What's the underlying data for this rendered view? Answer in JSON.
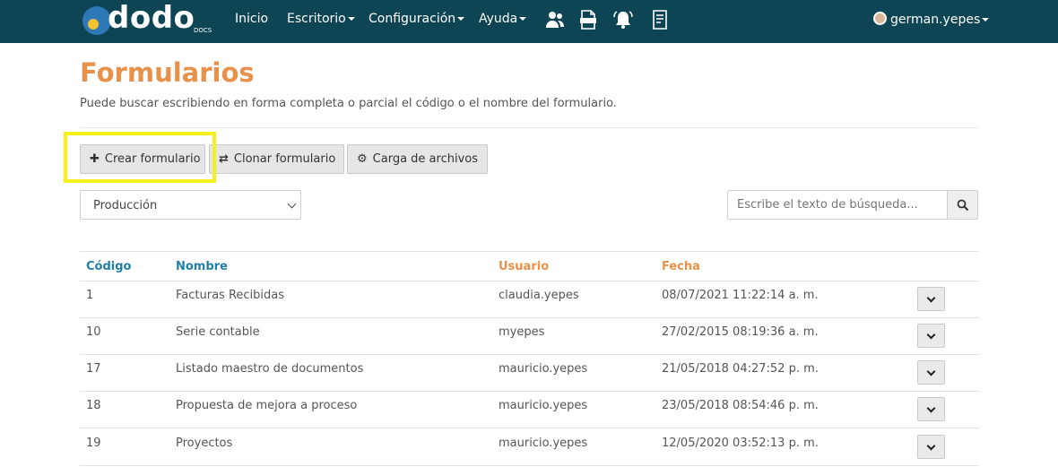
{
  "navbar": {
    "logo_text": "dodo",
    "logo_sub": "DOCS",
    "menu": [
      {
        "label": "Inicio",
        "dropdown": false
      },
      {
        "label": "Escritorio",
        "dropdown": true
      },
      {
        "label": "Configuración",
        "dropdown": true
      },
      {
        "label": "Ayuda",
        "dropdown": true
      }
    ],
    "icons": [
      "users-icon",
      "xlsx-file-icon",
      "bell-icon",
      "document-icon"
    ],
    "user": "german.yepes",
    "bg_color": "#0e4554"
  },
  "page": {
    "title": "Formularios",
    "description": "Puede buscar escribiendo en forma completa o parcial el código o el nombre del formulario.",
    "title_color": "#e8914a"
  },
  "toolbar": {
    "create_label": "Crear formulario",
    "clone_label": "Clonar formulario",
    "upload_label": "Carga de archivos"
  },
  "filter": {
    "environment_value": "Producción",
    "search_placeholder": "Escribe el texto de búsqueda..."
  },
  "table": {
    "columns": [
      "Código",
      "Nombre",
      "Usuario",
      "Fecha"
    ],
    "rows": [
      {
        "codigo": "1",
        "nombre": "Facturas Recibidas",
        "usuario": "claudia.yepes",
        "fecha": "08/07/2021 11:22:14 a. m."
      },
      {
        "codigo": "10",
        "nombre": "Serie contable",
        "usuario": "myepes",
        "fecha": "27/02/2015 08:19:36 a. m."
      },
      {
        "codigo": "17",
        "nombre": "Listado maestro de documentos",
        "usuario": "mauricio.yepes",
        "fecha": "21/05/2018 04:27:52 p. m."
      },
      {
        "codigo": "18",
        "nombre": "Propuesta de mejora a proceso",
        "usuario": "mauricio.yepes",
        "fecha": "23/05/2018 08:54:46 p. m."
      },
      {
        "codigo": "19",
        "nombre": "Proyectos",
        "usuario": "mauricio.yepes",
        "fecha": "12/05/2020 03:52:13 p. m."
      }
    ]
  },
  "highlight_color": "#f3f01a"
}
